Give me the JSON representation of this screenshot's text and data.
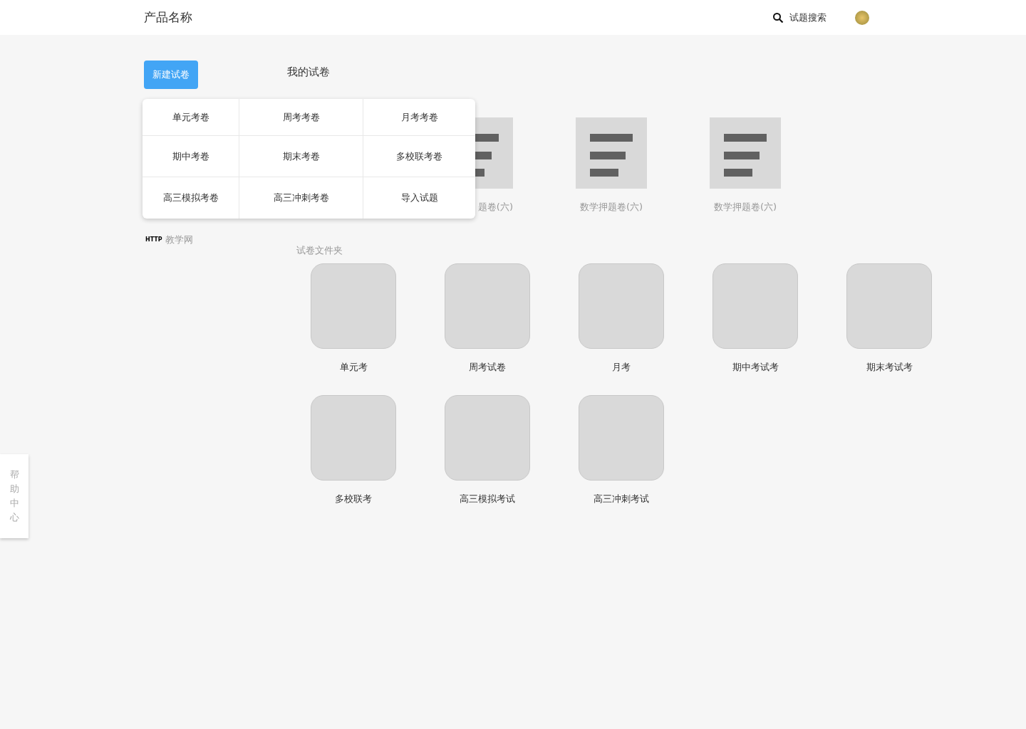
{
  "header": {
    "product_name": "产品名称",
    "search_label": "试题搜索"
  },
  "new_button": "新建试卷",
  "new_menu": [
    {
      "label": "单元考卷"
    },
    {
      "label": "周考考卷"
    },
    {
      "label": "月考考卷"
    },
    {
      "label": "期中考卷"
    },
    {
      "label": "期末考卷"
    },
    {
      "label": "多校联考卷"
    },
    {
      "label": "高三模拟考卷"
    },
    {
      "label": "高三冲刺考卷"
    },
    {
      "label": "导入试题"
    }
  ],
  "sidebar_link": {
    "badge": "HTTP",
    "label": "教学网"
  },
  "page_title": "我的试卷",
  "recent": [
    {
      "label": "题卷(六)"
    },
    {
      "label": "数学押题卷(六)"
    },
    {
      "label": "数学押题卷(六)"
    }
  ],
  "folders_title": "试卷文件夹",
  "folders": [
    {
      "label": "单元考"
    },
    {
      "label": "周考试卷"
    },
    {
      "label": "月考"
    },
    {
      "label": "期中考试考"
    },
    {
      "label": "期末考试考"
    },
    {
      "label": "多校联考"
    },
    {
      "label": "高三模拟考试"
    },
    {
      "label": "高三冲刺考试"
    }
  ],
  "help_tab": "帮助中心"
}
